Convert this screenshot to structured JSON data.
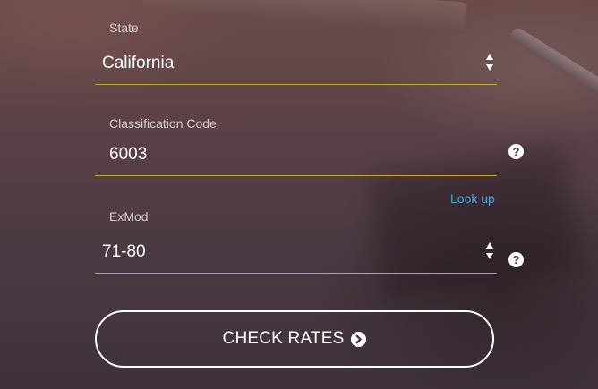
{
  "state": {
    "label": "State",
    "value": "California"
  },
  "classification": {
    "label": "Classification Code",
    "value": "6003",
    "help_icon": "question-circle-icon"
  },
  "lookup": {
    "label": "Look up"
  },
  "exmod": {
    "label": "ExMod",
    "value": "71-80",
    "help_icon": "question-circle-icon"
  },
  "submit": {
    "label": "CHECK RATES",
    "icon": "arrow-circle-right-icon"
  },
  "colors": {
    "underline": "#c9a640",
    "link": "#3fa7ec",
    "text": "#ffffff"
  }
}
